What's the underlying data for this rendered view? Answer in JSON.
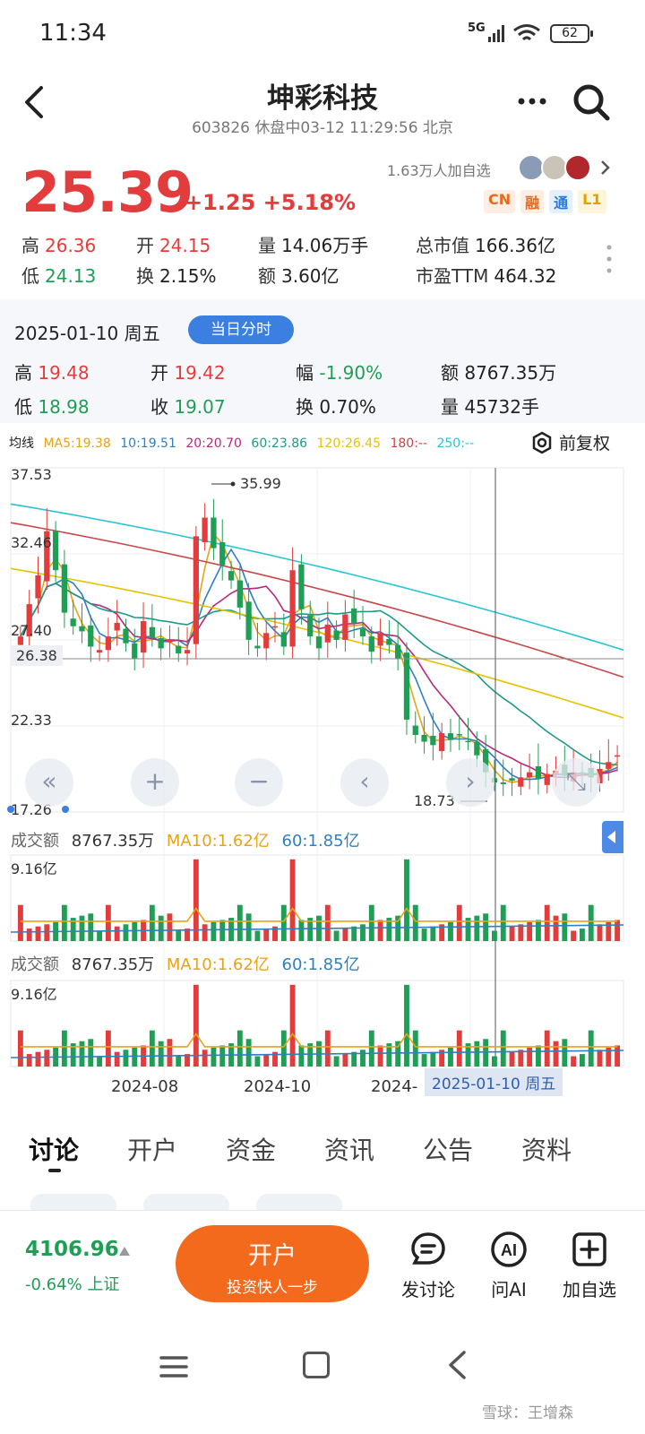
{
  "status_bar": {
    "time": "11:34",
    "signal": "5G",
    "battery": "62"
  },
  "header": {
    "title": "坤彩科技",
    "subtitle": "603826 休盘中03-12 11:29:56 北京"
  },
  "quote": {
    "price": "25.39",
    "change": "+1.25 +5.18%",
    "watchers": "1.63万人加自选",
    "tags": [
      "CN",
      "融",
      "通",
      "L1"
    ],
    "stats": [
      {
        "label": "高",
        "value": "26.36",
        "color": "red"
      },
      {
        "label": "开",
        "value": "24.15",
        "color": "red"
      },
      {
        "label": "量",
        "value": "14.06万手",
        "color": "none"
      },
      {
        "label": "总市值",
        "value": "166.36亿",
        "color": "none"
      },
      {
        "label": "低",
        "value": "24.13",
        "color": "green"
      },
      {
        "label": "换",
        "value": "2.15%",
        "color": "none"
      },
      {
        "label": "额",
        "value": "3.60亿",
        "color": "none"
      },
      {
        "label": "市盈TTM",
        "value": "464.32",
        "color": "none"
      }
    ]
  },
  "day_panel": {
    "date": "2025-01-10 周五",
    "pill": "当日分时",
    "cells": [
      {
        "label": "高",
        "value": "19.48",
        "color": "red"
      },
      {
        "label": "开",
        "value": "19.42",
        "color": "red"
      },
      {
        "label": "幅",
        "value": "-1.90%",
        "color": "green"
      },
      {
        "label": "额",
        "value": "8767.35万",
        "color": "none"
      },
      {
        "label": "低",
        "value": "18.98",
        "color": "green"
      },
      {
        "label": "收",
        "value": "19.07",
        "color": "green"
      },
      {
        "label": "换",
        "value": "0.70%",
        "color": "none"
      },
      {
        "label": "量",
        "value": "45732手",
        "color": "none"
      }
    ]
  },
  "ma_legend": {
    "title": "均线",
    "items": [
      {
        "text": "MA5:19.38",
        "color": "#e8a317"
      },
      {
        "text": "10:19.51",
        "color": "#2f7fc1"
      },
      {
        "text": "20:20.70",
        "color": "#b8287e"
      },
      {
        "text": "60:23.86",
        "color": "#1c9a8a"
      },
      {
        "text": "120:26.45",
        "color": "#e6c200"
      },
      {
        "text": "180:--",
        "color": "#c8474a"
      },
      {
        "text": "250:--",
        "color": "#27c4d4"
      }
    ],
    "adjust": "前复权"
  },
  "chart_data": {
    "type": "candlestick",
    "y_ticks": [
      "37.53",
      "32.46",
      "27.40",
      "22.33",
      "17.26"
    ],
    "ylim": [
      17.26,
      37.53
    ],
    "high_marker": "35.99",
    "low_marker": "18.73",
    "crosshair_price": "26.38",
    "crosshair_date": "2025-01-10 周五",
    "x_labels": [
      "2024-08",
      "2024-10",
      "2024-"
    ],
    "closes": [
      27.6,
      29.5,
      31.2,
      33.8,
      31.5,
      29.0,
      28.2,
      27.9,
      27.0,
      26.8,
      27.6,
      28.4,
      27.2,
      26.3,
      28.5,
      27.5,
      26.9,
      27.4,
      26.6,
      26.8,
      33.5,
      34.6,
      32.8,
      31.8,
      30.9,
      29.3,
      27.4,
      26.9,
      27.8,
      28.2,
      27.0,
      31.5,
      29.2,
      27.6,
      26.9,
      28.3,
      27.4,
      28.9,
      28.4,
      27.6,
      26.7,
      27.8,
      27.1,
      26.3,
      22.7,
      21.8,
      21.4,
      21.2,
      21.9,
      21.5,
      21.8,
      21.4,
      20.6,
      19.6,
      19.0,
      18.9,
      19.1,
      19.3,
      19.6,
      19.2,
      19.5,
      19.7,
      19.4,
      19.6,
      19.5,
      19.3,
      19.8,
      20.2,
      20.6
    ],
    "series": [
      {
        "name": "成交额 MA10",
        "values": [
          1.62
        ]
      },
      {
        "name": "60",
        "values": [
          1.85
        ]
      }
    ],
    "volume_ymax": "9.16亿",
    "volume_legend": {
      "label": "成交额",
      "value": "8767.35万",
      "ma10": "MA10:1.62亿",
      "ma60": "60:1.85亿"
    }
  },
  "tabs": [
    "讨论",
    "开户",
    "资金",
    "资讯",
    "公告",
    "资料"
  ],
  "action_bar": {
    "index_value": "4106.96",
    "index_sub": "-0.64% 上证",
    "open_big": "开户",
    "open_small": "投资快人一步",
    "actions": [
      "发讨论",
      "问AI",
      "加自选"
    ]
  },
  "watermark": "雪球：王增森"
}
